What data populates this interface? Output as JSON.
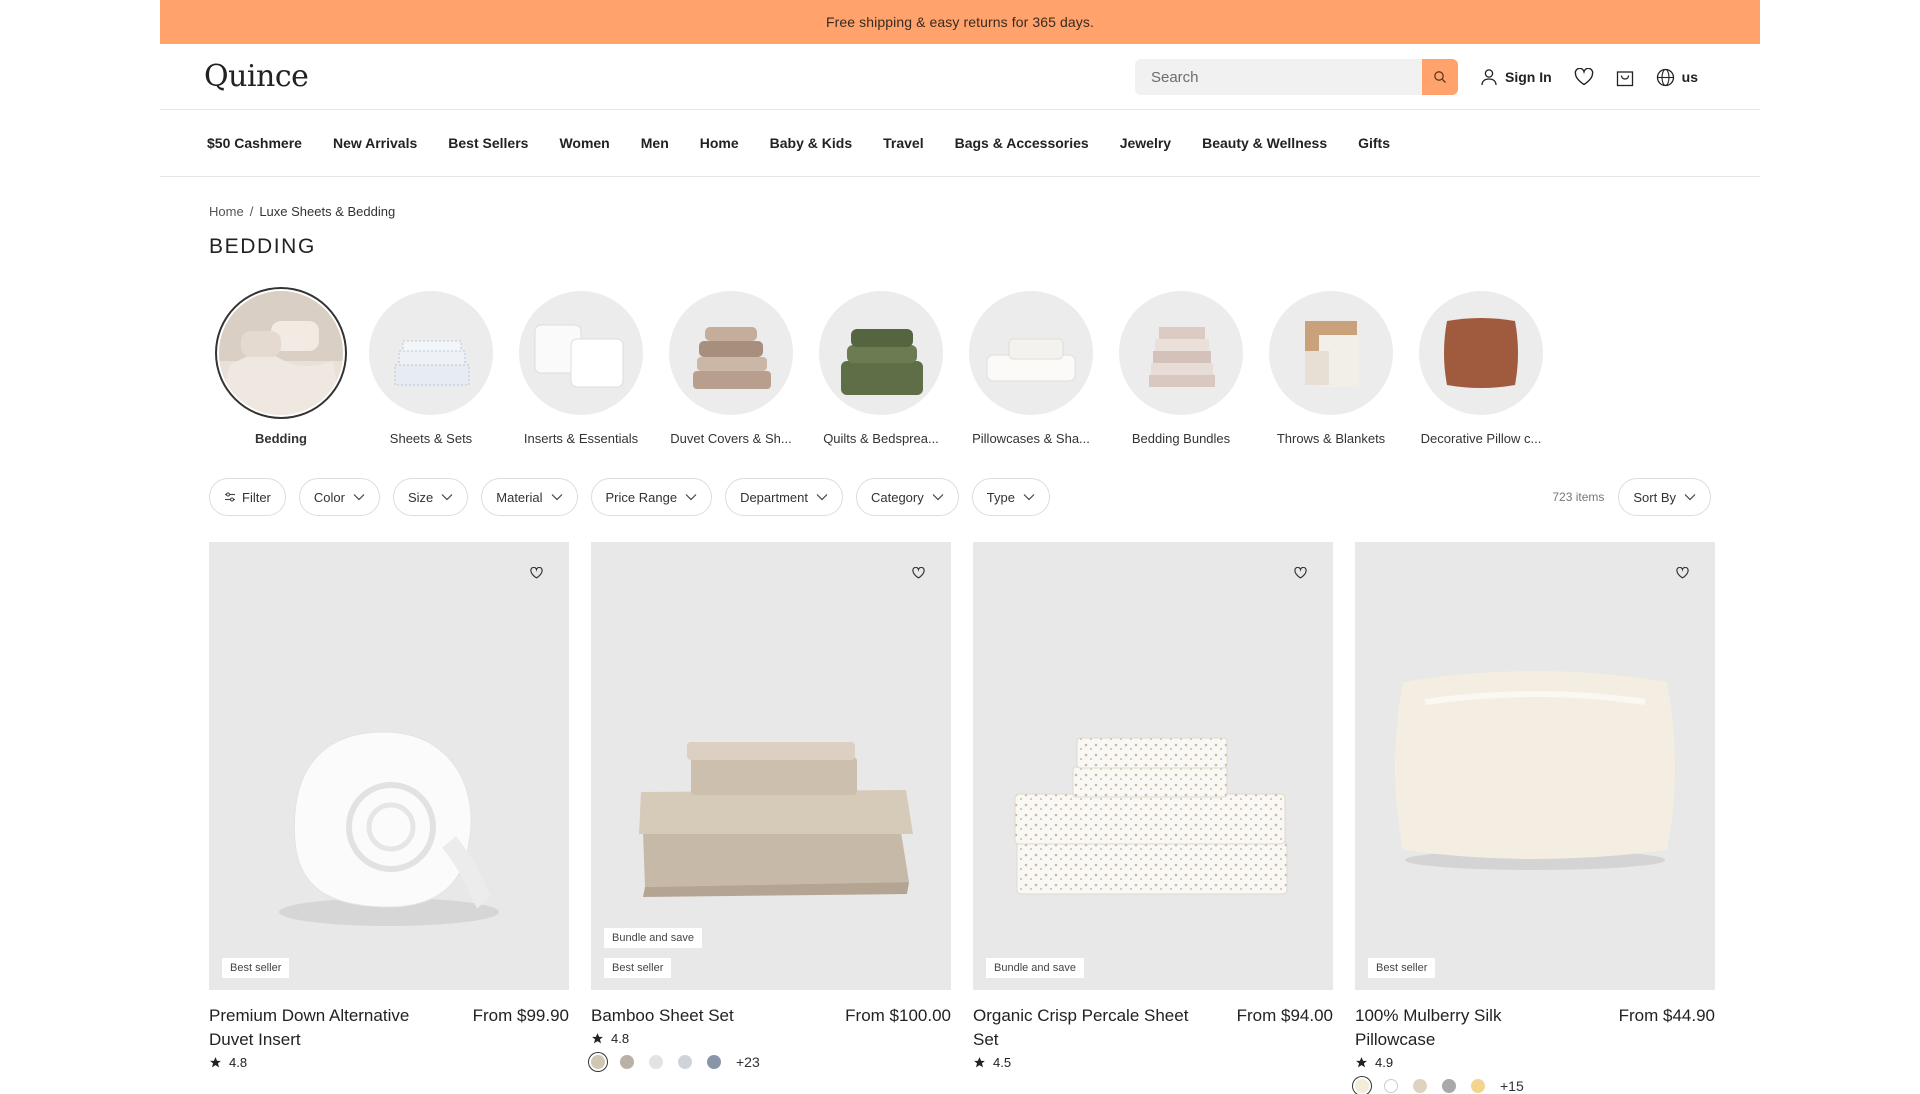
{
  "promo": {
    "text": "Free shipping & easy returns for 365 days."
  },
  "header": {
    "logo": "Quince",
    "search_placeholder": "Search",
    "sign_in": "Sign In",
    "region": "us"
  },
  "nav": [
    "$50 Cashmere",
    "New Arrivals",
    "Best Sellers",
    "Women",
    "Men",
    "Home",
    "Baby & Kids",
    "Travel",
    "Bags & Accessories",
    "Jewelry",
    "Beauty & Wellness",
    "Gifts"
  ],
  "breadcrumb": {
    "home": "Home",
    "current": "Luxe Sheets & Bedding"
  },
  "title": "BEDDING",
  "categories": [
    {
      "label": "Bedding",
      "active": true
    },
    {
      "label": "Sheets & Sets"
    },
    {
      "label": "Inserts & Essentials"
    },
    {
      "label": "Duvet Covers & Sh..."
    },
    {
      "label": "Quilts & Bedsprea..."
    },
    {
      "label": "Pillowcases & Sha..."
    },
    {
      "label": "Bedding Bundles"
    },
    {
      "label": "Throws & Blankets"
    },
    {
      "label": "Decorative Pillow c..."
    }
  ],
  "filters": [
    "Filter",
    "Color",
    "Size",
    "Material",
    "Price Range",
    "Department",
    "Category",
    "Type"
  ],
  "item_count": "723 items",
  "sort_label": "Sort By",
  "products": [
    {
      "name": "Premium Down Alternative Duvet Insert",
      "price": "From $99.90",
      "rating": "4.8",
      "badges": [
        "Best seller"
      ],
      "swatches": [],
      "more": ""
    },
    {
      "name": "Bamboo Sheet Set",
      "price": "From $100.00",
      "rating": "4.8",
      "badges": [
        "Bundle and save",
        "Best seller"
      ],
      "swatches": [
        "#cfc6b4",
        "#b9b1a6",
        "#e3e3e3",
        "#cfd4da",
        "#8a96a8"
      ],
      "more": "+23"
    },
    {
      "name": "Organic Crisp Percale Sheet Set",
      "price": "From $94.00",
      "rating": "4.5",
      "badges": [
        "Bundle and save"
      ],
      "swatches": [],
      "more": ""
    },
    {
      "name": "100% Mulberry Silk Pillowcase",
      "price": "From $44.90",
      "rating": "4.9",
      "badges": [
        "Best seller"
      ],
      "swatches": [
        "#f2ecd9",
        "#ffffff",
        "#ddd3c0",
        "#a9a9a9",
        "#f2d48e"
      ],
      "more": "+15"
    }
  ],
  "colors": {
    "accent": "#ffa26b"
  }
}
